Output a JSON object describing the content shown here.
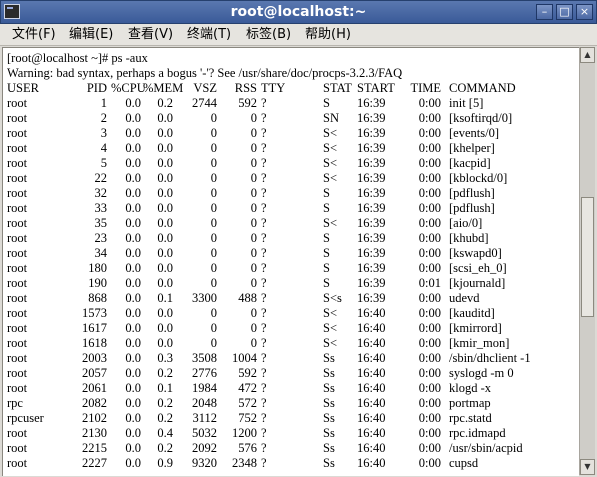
{
  "window": {
    "title": "root@localhost:~",
    "minimize_glyph": "–",
    "maximize_glyph": "□",
    "close_glyph": "×"
  },
  "menu": [
    "文件(F)",
    "编辑(E)",
    "查看(V)",
    "终端(T)",
    "标签(B)",
    "帮助(H)"
  ],
  "terminal": {
    "prompt_line": "[root@localhost ~]# ps -aux",
    "warning_line": "Warning: bad syntax, perhaps a bogus '-'? See /usr/share/doc/procps-3.2.3/FAQ",
    "headers": [
      "USER",
      "PID",
      "%CPU",
      "%MEM",
      "VSZ",
      "RSS",
      "TTY",
      "STAT",
      "START",
      "TIME",
      "COMMAND"
    ],
    "rows": [
      [
        "root",
        "1",
        "0.0",
        "0.2",
        "2744",
        "592",
        "?",
        "S",
        "16:39",
        "0:00",
        "init [5]"
      ],
      [
        "root",
        "2",
        "0.0",
        "0.0",
        "0",
        "0",
        "?",
        "SN",
        "16:39",
        "0:00",
        "[ksoftirqd/0]"
      ],
      [
        "root",
        "3",
        "0.0",
        "0.0",
        "0",
        "0",
        "?",
        "S<",
        "16:39",
        "0:00",
        "[events/0]"
      ],
      [
        "root",
        "4",
        "0.0",
        "0.0",
        "0",
        "0",
        "?",
        "S<",
        "16:39",
        "0:00",
        "[khelper]"
      ],
      [
        "root",
        "5",
        "0.0",
        "0.0",
        "0",
        "0",
        "?",
        "S<",
        "16:39",
        "0:00",
        "[kacpid]"
      ],
      [
        "root",
        "22",
        "0.0",
        "0.0",
        "0",
        "0",
        "?",
        "S<",
        "16:39",
        "0:00",
        "[kblockd/0]"
      ],
      [
        "root",
        "32",
        "0.0",
        "0.0",
        "0",
        "0",
        "?",
        "S",
        "16:39",
        "0:00",
        "[pdflush]"
      ],
      [
        "root",
        "33",
        "0.0",
        "0.0",
        "0",
        "0",
        "?",
        "S",
        "16:39",
        "0:00",
        "[pdflush]"
      ],
      [
        "root",
        "35",
        "0.0",
        "0.0",
        "0",
        "0",
        "?",
        "S<",
        "16:39",
        "0:00",
        "[aio/0]"
      ],
      [
        "root",
        "23",
        "0.0",
        "0.0",
        "0",
        "0",
        "?",
        "S",
        "16:39",
        "0:00",
        "[khubd]"
      ],
      [
        "root",
        "34",
        "0.0",
        "0.0",
        "0",
        "0",
        "?",
        "S",
        "16:39",
        "0:00",
        "[kswapd0]"
      ],
      [
        "root",
        "180",
        "0.0",
        "0.0",
        "0",
        "0",
        "?",
        "S",
        "16:39",
        "0:00",
        "[scsi_eh_0]"
      ],
      [
        "root",
        "190",
        "0.0",
        "0.0",
        "0",
        "0",
        "?",
        "S",
        "16:39",
        "0:01",
        "[kjournald]"
      ],
      [
        "root",
        "868",
        "0.0",
        "0.1",
        "3300",
        "488",
        "?",
        "S<s",
        "16:39",
        "0:00",
        "udevd"
      ],
      [
        "root",
        "1573",
        "0.0",
        "0.0",
        "0",
        "0",
        "?",
        "S<",
        "16:40",
        "0:00",
        "[kauditd]"
      ],
      [
        "root",
        "1617",
        "0.0",
        "0.0",
        "0",
        "0",
        "?",
        "S<",
        "16:40",
        "0:00",
        "[kmirrord]"
      ],
      [
        "root",
        "1618",
        "0.0",
        "0.0",
        "0",
        "0",
        "?",
        "S<",
        "16:40",
        "0:00",
        "[kmir_mon]"
      ],
      [
        "root",
        "2003",
        "0.0",
        "0.3",
        "3508",
        "1004",
        "?",
        "Ss",
        "16:40",
        "0:00",
        "/sbin/dhclient -1"
      ],
      [
        "root",
        "2057",
        "0.0",
        "0.2",
        "2776",
        "592",
        "?",
        "Ss",
        "16:40",
        "0:00",
        "syslogd -m 0"
      ],
      [
        "root",
        "2061",
        "0.0",
        "0.1",
        "1984",
        "472",
        "?",
        "Ss",
        "16:40",
        "0:00",
        "klogd -x"
      ],
      [
        "rpc",
        "2082",
        "0.0",
        "0.2",
        "2048",
        "572",
        "?",
        "Ss",
        "16:40",
        "0:00",
        "portmap"
      ],
      [
        "rpcuser",
        "2102",
        "0.0",
        "0.2",
        "3112",
        "752",
        "?",
        "Ss",
        "16:40",
        "0:00",
        "rpc.statd"
      ],
      [
        "root",
        "2130",
        "0.0",
        "0.4",
        "5032",
        "1200",
        "?",
        "Ss",
        "16:40",
        "0:00",
        "rpc.idmapd"
      ],
      [
        "root",
        "2215",
        "0.0",
        "0.2",
        "2092",
        "576",
        "?",
        "Ss",
        "16:40",
        "0:00",
        "/usr/sbin/acpid"
      ],
      [
        "root",
        "2227",
        "0.0",
        "0.9",
        "9320",
        "2348",
        "?",
        "Ss",
        "16:40",
        "0:00",
        "cupsd"
      ]
    ]
  }
}
